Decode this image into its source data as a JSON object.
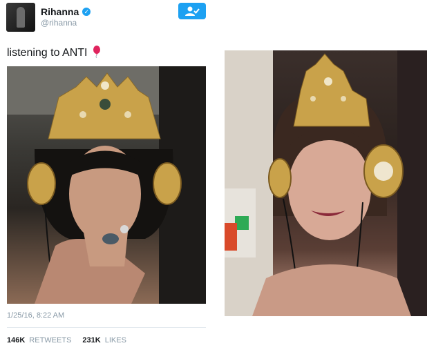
{
  "tweet": {
    "display_name": "Rihanna",
    "verified_icon": "verified-badge-icon",
    "handle": "@rihanna",
    "follow_icon": "follow-user-icon",
    "text": "listening to ANTI",
    "emoji": "balloon-icon",
    "timestamp": "1/25/16, 8:22 AM",
    "retweets_count": "146K",
    "retweets_label": "RETWEETS",
    "likes_count": "231K",
    "likes_label": "LIKES"
  },
  "colors": {
    "accent": "#1da1f2",
    "muted_text": "#8899a6",
    "primary_text": "#14171a",
    "balloon": "#e0245e",
    "gold": "#c9a24a"
  }
}
